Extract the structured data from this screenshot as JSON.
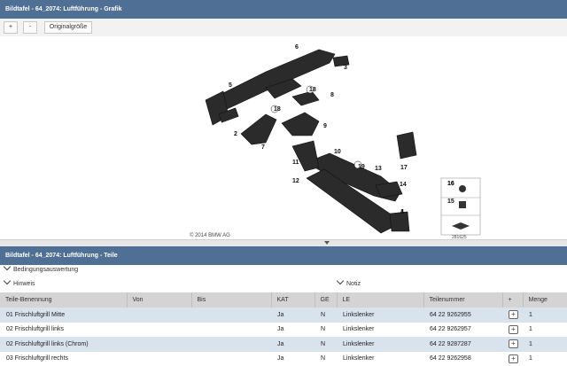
{
  "graphic_panel": {
    "title": "Bildtafel - 64_2074: Luftführung - Grafik",
    "zoom_in_label": "+",
    "zoom_out_label": "-",
    "original_size_label": "Originalgröße",
    "copyright": "© 2014 BMW AG",
    "image_number": "281625",
    "callouts": [
      "1",
      "2",
      "3",
      "4",
      "5",
      "6",
      "7",
      "8",
      "9",
      "10",
      "11",
      "12",
      "13",
      "14",
      "15",
      "16",
      "16",
      "17",
      "18",
      "18",
      "19"
    ]
  },
  "parts_panel": {
    "title": "Bildtafel - 64_2074: Luftführung - Teile",
    "conditions_label": "Bedingungsauswertung",
    "hint_label": "Hinweis",
    "note_label": "Notiz",
    "columns": [
      "Teile-Benennung",
      "Von",
      "Bis",
      "KAT",
      "GE",
      "LE",
      "Teilenummer",
      "+",
      "Menge"
    ],
    "rows": [
      {
        "name": "01 Frischluftgrill Mitte",
        "von": "",
        "bis": "",
        "kat": "Ja",
        "ge": "N",
        "le": "Linkslenker",
        "part_no": "64 22 9262955",
        "cart": "+",
        "qty": "1"
      },
      {
        "name": "02 Frischluftgrill links",
        "von": "",
        "bis": "",
        "kat": "Ja",
        "ge": "N",
        "le": "Linkslenker",
        "part_no": "64 22 9262957",
        "cart": "+",
        "qty": "1"
      },
      {
        "name": "02 Frischluftgrill links (Chrom)",
        "von": "",
        "bis": "",
        "kat": "Ja",
        "ge": "N",
        "le": "Linkslenker",
        "part_no": "64 22 9287287",
        "cart": "+",
        "qty": "1"
      },
      {
        "name": "03 Frischluftgrill rechts",
        "von": "",
        "bis": "",
        "kat": "Ja",
        "ge": "N",
        "le": "Linkslenker",
        "part_no": "64 22 9262958",
        "cart": "+",
        "qty": "1"
      }
    ]
  }
}
